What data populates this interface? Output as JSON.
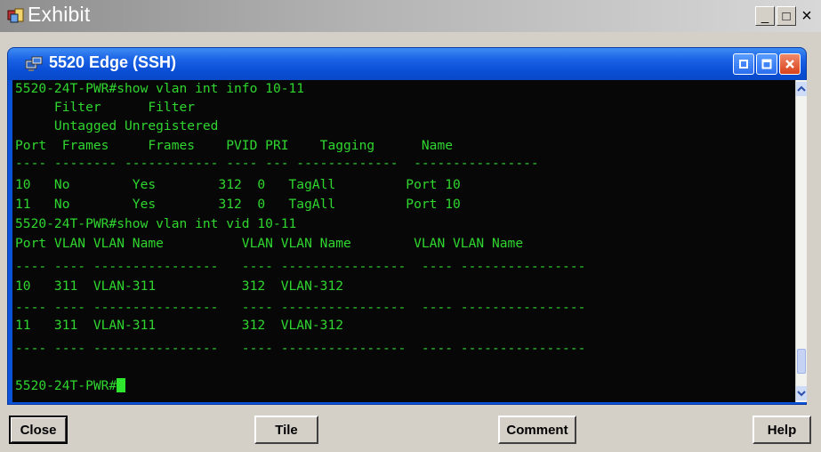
{
  "outer_window": {
    "title": "Exhibit",
    "controls": {
      "minimize": "_",
      "maximize": "□",
      "close": "×"
    }
  },
  "ssh_window": {
    "title": "5520 Edge (SSH)"
  },
  "terminal": {
    "lines": [
      "5520-24T-PWR#show vlan int info 10-11",
      "     Filter      Filter",
      "     Untagged Unregistered",
      "Port  Frames     Frames    PVID PRI    Tagging      Name",
      "---- -------- ------------ ---- --- -------------  ----------------",
      "10   No        Yes        312  0   TagAll         Port 10",
      "11   No        Yes        312  0   TagAll         Port 10",
      "5520-24T-PWR#show vlan int vid 10-11",
      "Port VLAN VLAN Name          VLAN VLAN Name        VLAN VLAN Name",
      "---- ---- ----------------   ---- ----------------  ---- ----------------",
      "10   311  VLAN-311           312  VLAN-312",
      "---- ---- ----------------   ---- ----------------  ---- ----------------",
      "11   311  VLAN-311           312  VLAN-312",
      "---- ---- ----------------   ---- ----------------  ---- ----------------"
    ],
    "prompt": "5520-24T-PWR#"
  },
  "buttons": {
    "close": "Close",
    "tile": "Tile",
    "comment": "Comment",
    "help": "Help"
  },
  "colors": {
    "terminal_bg": "#070707",
    "terminal_text": "#2fd62f",
    "titlebar_blue": "#0a52d8"
  }
}
